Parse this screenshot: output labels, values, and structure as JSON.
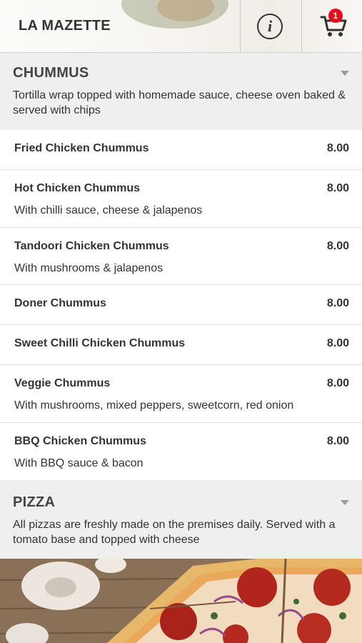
{
  "header": {
    "brand": "LA MAZETTE",
    "cart_count": "1"
  },
  "sections": [
    {
      "title": "CHUMMUS",
      "description": "Tortilla wrap topped with homemade sauce, cheese oven baked & served with chips",
      "items": [
        {
          "name": "Fried Chicken Chummus",
          "price": "8.00",
          "description": ""
        },
        {
          "name": "Hot Chicken Chummus",
          "price": "8.00",
          "description": "With chilli sauce, cheese & jalapenos"
        },
        {
          "name": "Tandoori Chicken Chummus",
          "price": "8.00",
          "description": "With mushrooms & jalapenos"
        },
        {
          "name": "Doner Chummus",
          "price": "8.00",
          "description": ""
        },
        {
          "name": "Sweet Chilli Chicken Chummus",
          "price": "8.00",
          "description": ""
        },
        {
          "name": "Veggie Chummus",
          "price": "8.00",
          "description": "With mushrooms, mixed peppers, sweetcorn, red onion"
        },
        {
          "name": "BBQ Chicken Chummus",
          "price": "8.00",
          "description": "With BBQ sauce & bacon"
        }
      ]
    },
    {
      "title": "PIZZA",
      "description": "All pizzas are freshly made on the premises daily. Served with a tomato base and topped with cheese"
    }
  ],
  "icons": {
    "info": "info-icon",
    "cart": "shopping-cart-icon",
    "collapse": "chevron-down-icon"
  },
  "colors": {
    "badge": "#e2101b",
    "section_bg": "#efefef"
  }
}
